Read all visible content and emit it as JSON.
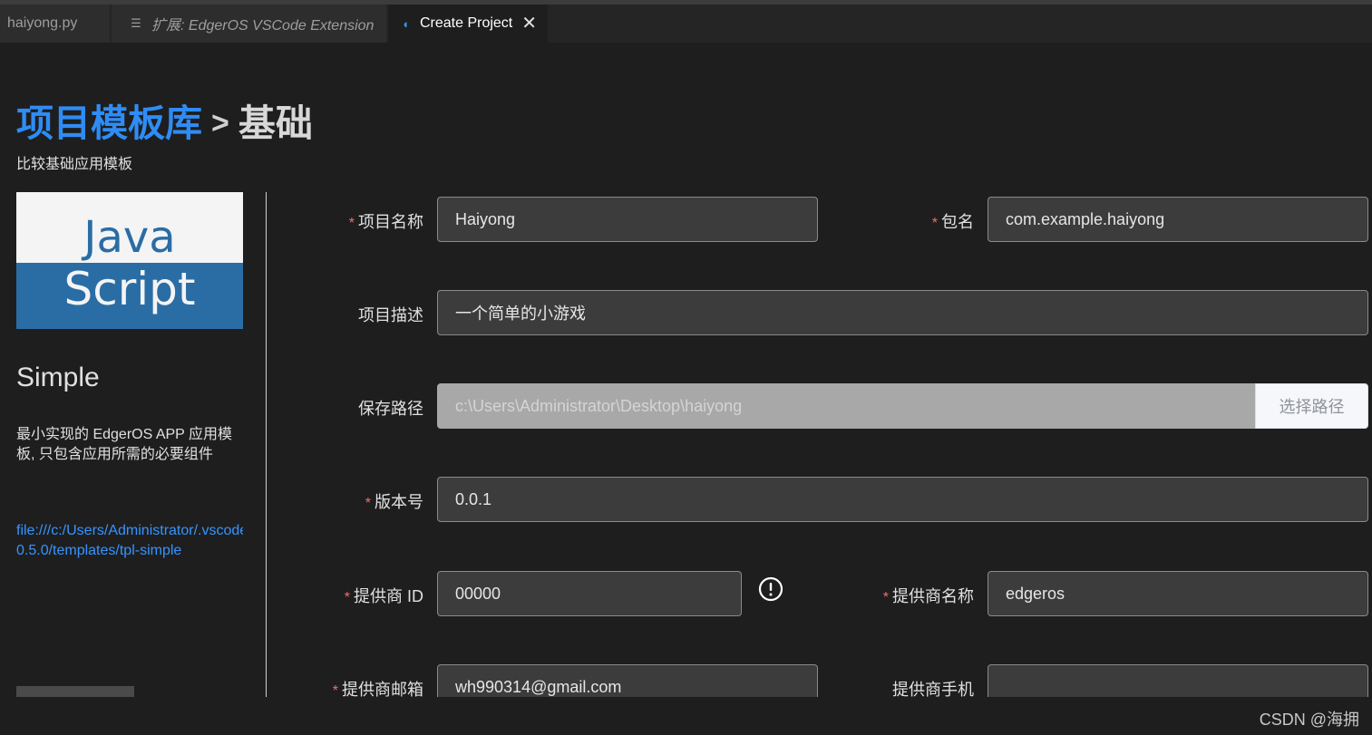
{
  "tabs": [
    {
      "icon": "",
      "label": "haiyong.py",
      "active": false
    },
    {
      "icon": "list-icon",
      "label": "扩展: EdgerOS VSCode Extension",
      "active": false
    },
    {
      "icon": "edgeros-icon",
      "label": "Create Project",
      "active": true
    }
  ],
  "header": {
    "title_link": "项目模板库",
    "separator": ">",
    "title_current": "基础",
    "subtitle": "比较基础应用模板"
  },
  "template": {
    "logo_line1": "Java",
    "logo_line2": "Script",
    "name": "Simple",
    "description": "最小实现的 EdgerOS APP 应用模板, 只包含应用所需的必要组件",
    "path_line1": "file:///c:/Users/Administrator/.vscode",
    "path_line2": "0.5.0/templates/tpl-simple"
  },
  "form": {
    "project_name": {
      "label": "项目名称",
      "required": "*",
      "value": "Haiyong"
    },
    "package_name": {
      "label": "包名",
      "required": "*",
      "value": "com.example.haiyong"
    },
    "project_desc": {
      "label": "项目描述",
      "value": "一个简单的小游戏"
    },
    "save_path": {
      "label": "保存路径",
      "value": "c:\\Users\\Administrator\\Desktop\\haiyong",
      "button": "选择路径"
    },
    "version": {
      "label": "版本号",
      "required": "*",
      "value": "0.0.1"
    },
    "vendor_id": {
      "label": "提供商 ID",
      "required": "*",
      "value": "00000",
      "warning_icon": "exclamation-circle-icon"
    },
    "vendor_name": {
      "label": "提供商名称",
      "required": "*",
      "value": "edgeros"
    },
    "vendor_email": {
      "label": "提供商邮箱",
      "required": "*",
      "value": "wh990314@gmail.com"
    },
    "vendor_phone": {
      "label": "提供商手机",
      "value": ""
    }
  },
  "watermark": "CSDN @海拥 ",
  "colors": {
    "accent": "#2f8cf5",
    "required": "#f56c6c",
    "link": "#3794ff",
    "js_blue": "#2a6da5"
  }
}
